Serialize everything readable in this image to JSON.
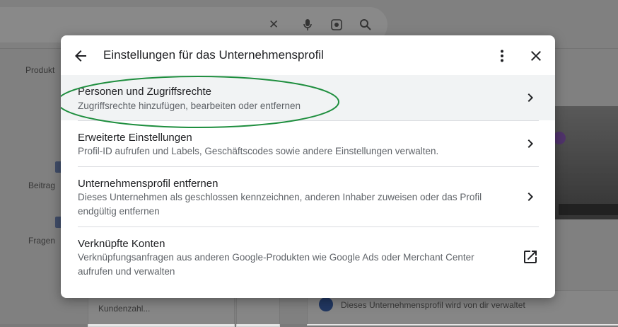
{
  "dialog": {
    "title": "Einstellungen für das Unternehmensprofil",
    "icons": {
      "back": "arrow-back-icon",
      "more": "more-vert-icon",
      "close": "close-icon"
    },
    "items": [
      {
        "title": "Personen und Zugriffsrechte",
        "subtitle": "Zugriffsrechte hinzufügen, bearbeiten oder entfernen",
        "action_icon": "chevron-right-icon",
        "highlighted": true
      },
      {
        "title": "Erweiterte Einstellungen",
        "subtitle": "Profil-ID aufrufen und Labels, Geschäftscodes sowie andere Einstellungen verwalten.",
        "action_icon": "chevron-right-icon"
      },
      {
        "title": "Unternehmensprofil entfernen",
        "subtitle": "Dieses Unternehmen als geschlossen kennzeichnen, anderen Inhaber zuweisen oder das Profil endgültig entfernen",
        "action_icon": "chevron-right-icon"
      },
      {
        "title": "Verknüpfte Konten",
        "subtitle": "Verknüpfungsanfragen aus anderen Google-Produkten wie Google Ads oder Merchant Center aufrufen und verwalten",
        "action_icon": "open-in-new-icon"
      }
    ]
  },
  "background": {
    "search_icons": [
      "clear-icon",
      "mic-icon",
      "lens-icon",
      "search-icon"
    ],
    "labels": {
      "produkt": "Produkt",
      "beitrag": "Beitrag",
      "fragen": "Fragen",
      "kundenzahl": "Kundenzahl...",
      "profil_verwaltet": "Dieses Unternehmensprofil wird von dir verwaltet"
    }
  },
  "colors": {
    "highlight_row": "#f1f3f4",
    "annotation_oval": "#1e8e3e",
    "scrim": "#000000"
  }
}
